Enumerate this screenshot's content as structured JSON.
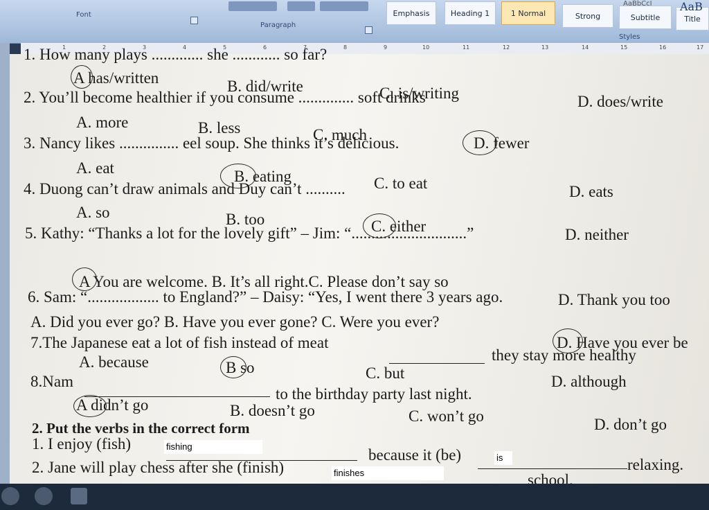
{
  "ribbon": {
    "font_group": "Font",
    "paragraph_group": "Paragraph",
    "styles_group": "Styles",
    "styles": [
      "Emphasis",
      "Heading 1",
      "1 Normal",
      "Strong",
      "Subtitle",
      "Title"
    ],
    "style_previews": [
      "AaBbCcI",
      "AaB"
    ]
  },
  "ruler": [
    "1",
    "2",
    "3",
    "4",
    "5",
    "6",
    "7",
    "8",
    "9",
    "10",
    "11",
    "12",
    "13",
    "14",
    "15",
    "16",
    "17"
  ],
  "questions": {
    "q1_stem": "1. How many plays ............. she ............ so far?",
    "q1_a": "A has/written",
    "q1_b": "B. did/write",
    "q1_c": "C. is/writing",
    "q1_d": "D. does/write",
    "q2_stem": "2. You’ll become healthier if you consume .............. soft drinks",
    "q2_a": "A. more",
    "q2_b": "B. less",
    "q2_c": "C. much",
    "q2_d": "D. fewer",
    "q3_stem": "3. Nancy likes ............... eel soup. She thinks it’s delicious.",
    "q3_a": "A. eat",
    "q3_b": "B. eating",
    "q3_c": "C. to eat",
    "q3_d": "D. eats",
    "q4_stem": "4. Duong can’t draw animals and Duy can’t ..........",
    "q4_a": "A. so",
    "q4_b": "B. too",
    "q4_c": "C. either",
    "q4_d": "D. neither",
    "q5_stem": "5. Kathy: “Thanks a lot for the lovely gift” – Jim: “.............................”",
    "q5_options": "A You are welcome.   B. It’s all right.C. Please don’t say so",
    "q5_d": "D. Thank you too",
    "q6_stem": "6. Sam: “.................. to England?” – Daisy: “Yes, I went there 3 years ago.",
    "q6_options": "A. Did you ever go?     B. Have you ever gone?   C. Were you ever?",
    "q6_d": "D. Have you ever be",
    "q7_stem": "7.The Japanese eat a lot of fish  instead of meat",
    "q7_tail": "they stay more healthy",
    "q7_a": "A. because",
    "q7_b": "B so",
    "q7_c": "C. but",
    "q7_d": "D. although",
    "q8_stem": "8.Nam",
    "q8_tail": "to the birthday party last night.",
    "q8_a": "A didn’t go",
    "q8_b": "B. doesn’t go",
    "q8_c": "C. won’t go",
    "q8_d": "D. don’t go",
    "section2_title": "2. Put the verbs in the correct form",
    "v1_stem": "1. I enjoy (fish)",
    "v1_tail": "because it (be)",
    "v1_end": "relaxing.",
    "v2_stem": "2. Jane will play chess after she (finish)",
    "v2_end": "school."
  },
  "answers": {
    "fishing": "fishing",
    "is": "is",
    "finishes": "finishes"
  }
}
